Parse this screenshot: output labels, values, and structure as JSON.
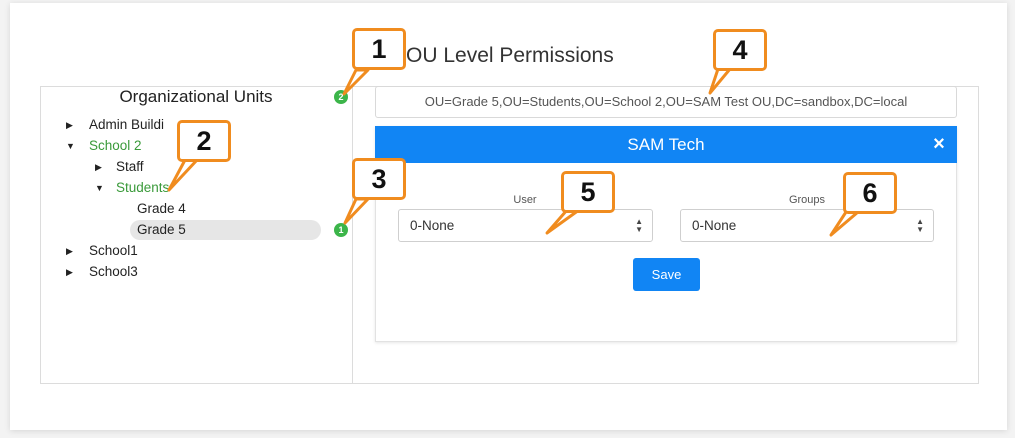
{
  "page_title": "OU Level Permissions",
  "org_units": {
    "title": "Organizational Units",
    "tree": {
      "admin": "Admin Buildi",
      "school2": "School 2",
      "staff": "Staff",
      "students": "Students",
      "grade4": "Grade 4",
      "grade5": "Grade 5",
      "school1": "School1",
      "school3": "School3"
    },
    "badge_top": "2",
    "badge_selected": "1"
  },
  "dn_path": "OU=Grade 5,OU=Students,OU=School 2,OU=SAM Test OU,DC=sandbox,DC=local",
  "panel": {
    "title": "SAM Tech",
    "close_symbol": "×",
    "user": {
      "label": "User",
      "value": "0-None"
    },
    "groups": {
      "label": "Groups",
      "value": "0-None"
    },
    "save_label": "Save"
  },
  "callouts": [
    "1",
    "2",
    "3",
    "4",
    "5",
    "6"
  ],
  "colors": {
    "accent_blue": "#1185f4",
    "callout_orange": "#f08c1f",
    "tree_green": "#3a9a3a",
    "badge_green": "#3cb54a"
  }
}
